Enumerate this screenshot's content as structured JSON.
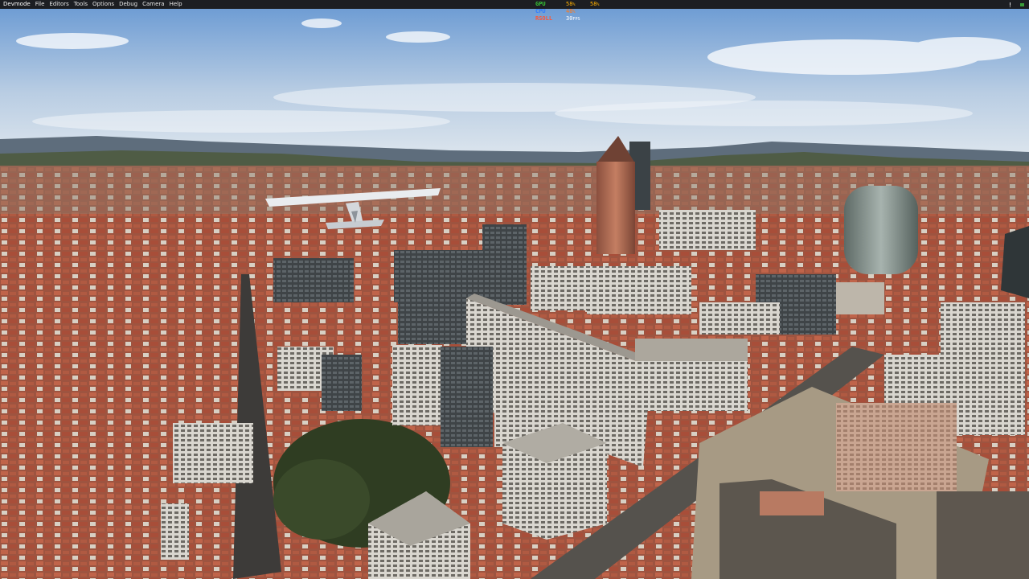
{
  "menubar": {
    "items": [
      "Devmode",
      "File",
      "Editors",
      "Tools",
      "Options",
      "Debug",
      "Camera",
      "Help"
    ]
  },
  "perf": {
    "rows": [
      {
        "label": "GPU",
        "value": "58",
        "unit": "%",
        "value2": "58",
        "unit2": "%",
        "label_color": "#37c837",
        "value_color": "#ffb000"
      },
      {
        "label": "CPU",
        "value": "48",
        "unit": "%",
        "value2": "",
        "unit2": "",
        "label_color": "#2f7dff",
        "value_color": "#ff7a1a"
      },
      {
        "label": "RSOLL",
        "value": "30",
        "unit": "FPS",
        "value2": "",
        "unit2": "",
        "label_color": "#ff5533",
        "value_color": "#ffffff"
      }
    ]
  },
  "colors": {
    "sky_top": "#6f9dd4",
    "sky_bottom": "#dfe7ee",
    "roof": "#b2553c",
    "building": "#c9c4ba"
  }
}
